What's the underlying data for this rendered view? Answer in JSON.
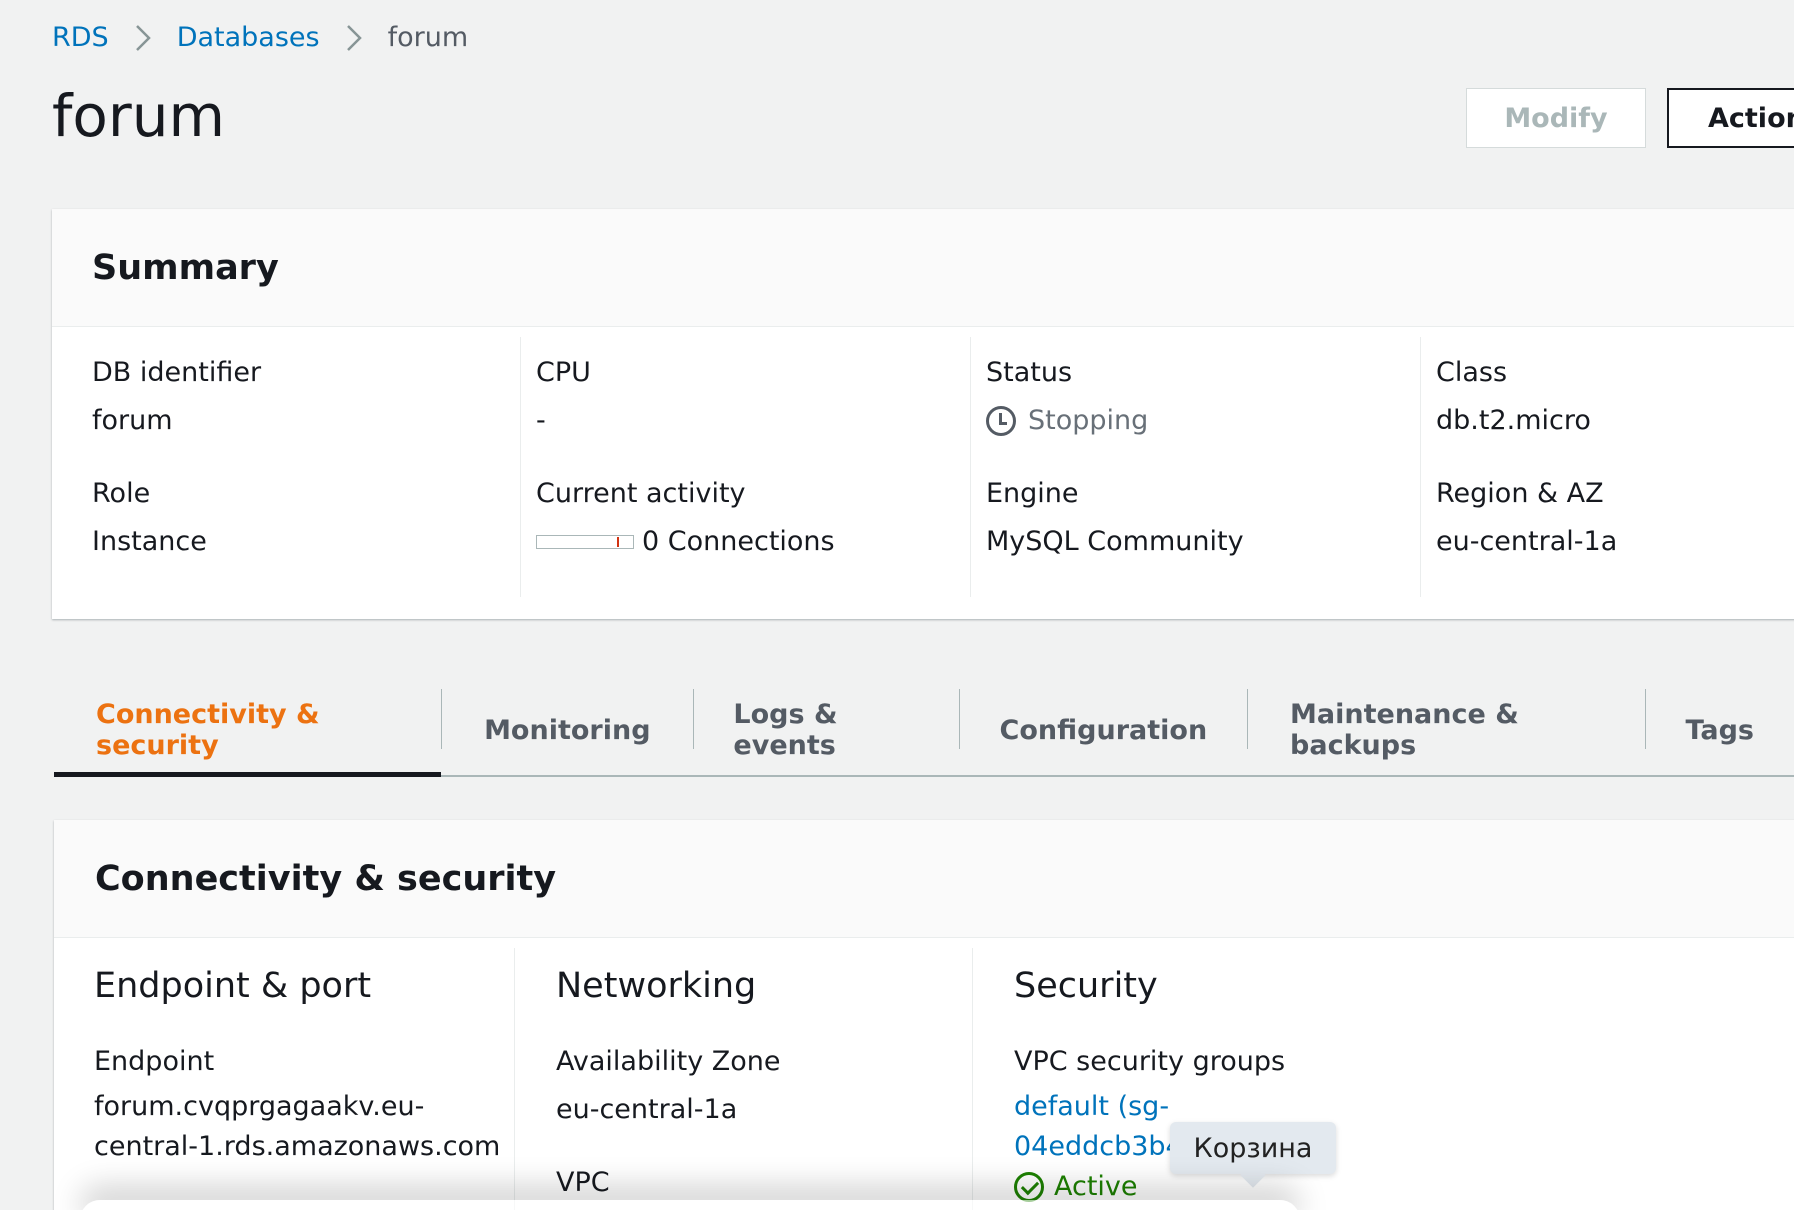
{
  "breadcrumb": {
    "rds": "RDS",
    "databases": "Databases",
    "current": "forum"
  },
  "page": {
    "title": "forum"
  },
  "buttons": {
    "modify": "Modify",
    "actions": "Action"
  },
  "summary": {
    "title": "Summary",
    "db_identifier_label": "DB identifier",
    "db_identifier": "forum",
    "role_label": "Role",
    "role": "Instance",
    "cpu_label": "CPU",
    "cpu": "-",
    "activity_label": "Current activity",
    "activity": "0 Connections",
    "status_label": "Status",
    "status": "Stopping",
    "engine_label": "Engine",
    "engine": "MySQL Community",
    "class_label": "Class",
    "class": "db.t2.micro",
    "region_label": "Region & AZ",
    "region": "eu-central-1a"
  },
  "tabs": [
    {
      "label": "Connectivity & security",
      "active": true
    },
    {
      "label": "Monitoring"
    },
    {
      "label": "Logs & events"
    },
    {
      "label": "Configuration"
    },
    {
      "label": "Maintenance & backups"
    },
    {
      "label": "Tags"
    }
  ],
  "connectivity": {
    "title": "Connectivity & security",
    "endpoint_section": "Endpoint & port",
    "endpoint_label": "Endpoint",
    "endpoint_line1": "forum.cvqprgagaakv.eu-",
    "endpoint_line2": "central-1.rds.amazonaws.com",
    "networking_section": "Networking",
    "az_label": "Availability Zone",
    "az": "eu-central-1a",
    "vpc_label": "VPC",
    "security_section": "Security",
    "sg_label": "VPC security groups",
    "sg_line1": "default (sg-",
    "sg_line2": "04eddcb3b4",
    "sg_status": "Active"
  },
  "tooltip": {
    "text": "Корзина"
  },
  "colors": {
    "link": "#0073bb",
    "active_tab": "#ec7211",
    "success": "#1d8102",
    "background": "#f1f2f2"
  }
}
